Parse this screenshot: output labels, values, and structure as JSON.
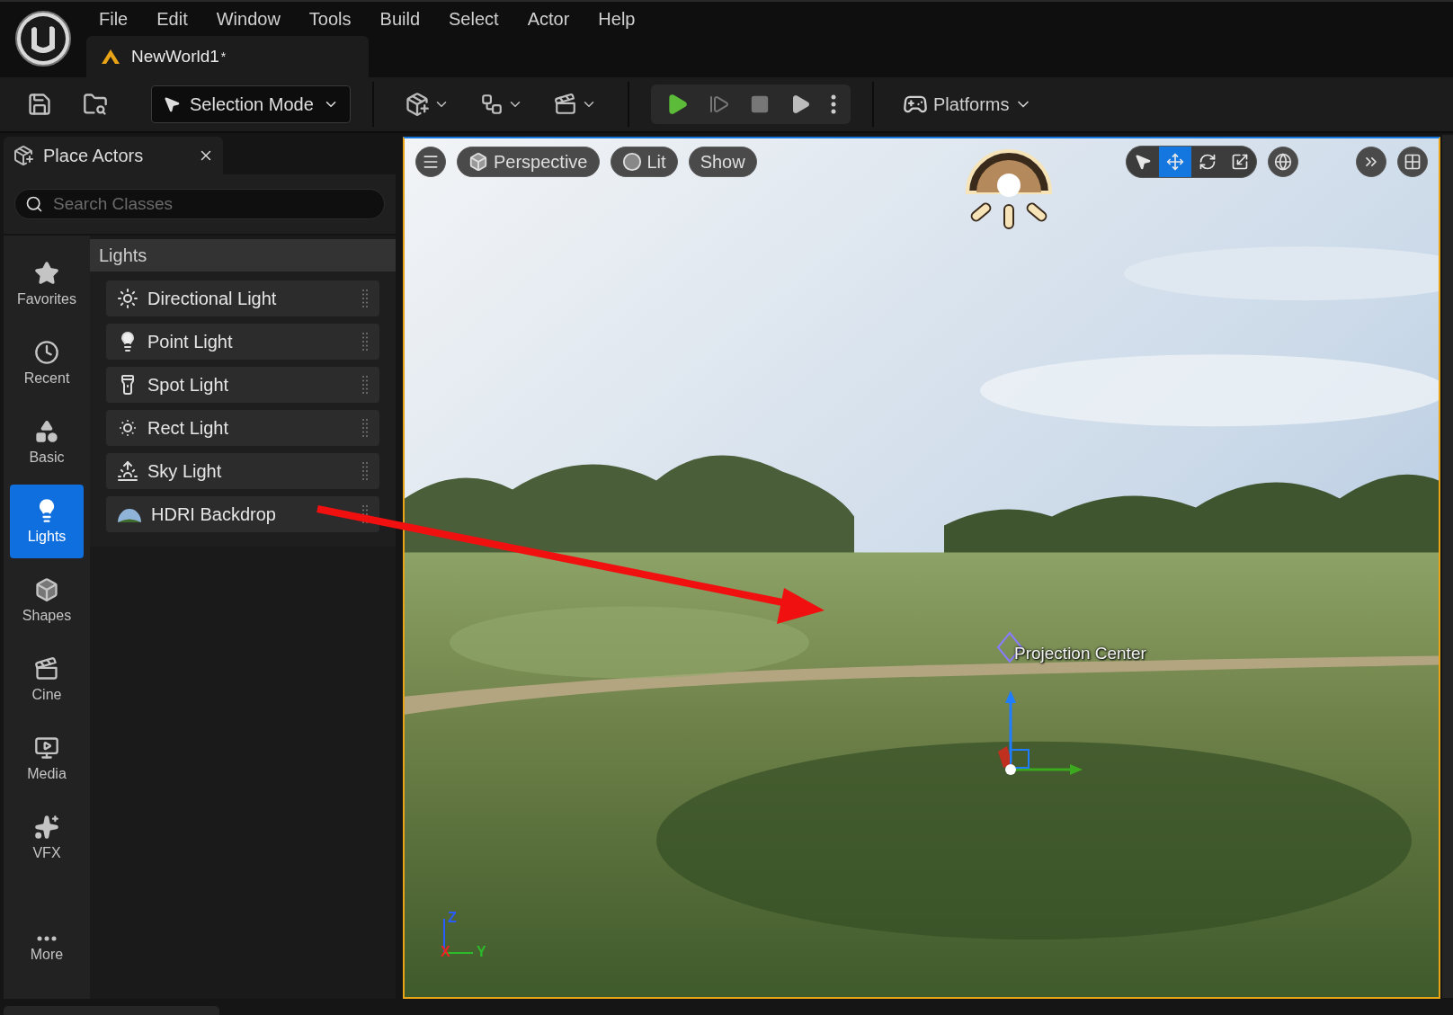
{
  "menu": [
    "File",
    "Edit",
    "Window",
    "Tools",
    "Build",
    "Select",
    "Actor",
    "Help"
  ],
  "document_tab": {
    "title": "NewWorld1",
    "modified_mark": "*"
  },
  "toolbar": {
    "mode": "Selection Mode",
    "platforms": "Platforms"
  },
  "place_actors": {
    "title": "Place Actors",
    "search_placeholder": "Search Classes",
    "categories": [
      {
        "label": "Favorites",
        "kind": "favorites",
        "selected": false
      },
      {
        "label": "Recent",
        "kind": "recent",
        "selected": false
      },
      {
        "label": "Basic",
        "kind": "basic",
        "selected": false
      },
      {
        "label": "Lights",
        "kind": "lights",
        "selected": true
      },
      {
        "label": "Shapes",
        "kind": "shapes",
        "selected": false
      },
      {
        "label": "Cine",
        "kind": "cine",
        "selected": false
      },
      {
        "label": "Media",
        "kind": "media",
        "selected": false
      },
      {
        "label": "VFX",
        "kind": "vfx",
        "selected": false
      },
      {
        "label": "More",
        "kind": "more",
        "selected": false
      }
    ],
    "section": "Lights",
    "items": [
      {
        "label": "Directional Light",
        "kind": "directional"
      },
      {
        "label": "Point Light",
        "kind": "point"
      },
      {
        "label": "Spot Light",
        "kind": "spot"
      },
      {
        "label": "Rect Light",
        "kind": "rect"
      },
      {
        "label": "Sky Light",
        "kind": "sky"
      },
      {
        "label": "HDRI Backdrop",
        "kind": "hdri"
      }
    ]
  },
  "viewport": {
    "view": "Perspective",
    "lighting": "Lit",
    "show": "Show",
    "transform_tools": [
      {
        "kind": "select",
        "selected": false
      },
      {
        "kind": "move",
        "selected": true
      },
      {
        "kind": "rotate",
        "selected": false
      },
      {
        "kind": "scale",
        "selected": false
      }
    ],
    "actor_label": "Projection Center",
    "axes": {
      "z": "Z",
      "x": "X",
      "y": "Y"
    }
  }
}
